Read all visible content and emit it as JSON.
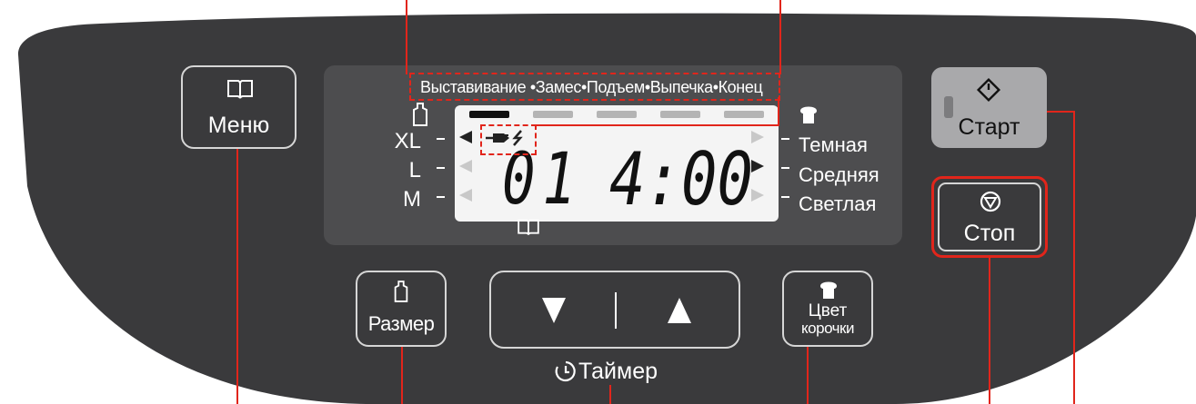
{
  "colors": {
    "panel": "#3a3a3c",
    "display": "#4d4d4f",
    "lcd": "#f4f4f4",
    "accent": "#e1251b",
    "start_button": "#a9a9ab"
  },
  "menu_button": {
    "label": "Меню",
    "icon": "book-icon"
  },
  "stages": [
    "Выставивание",
    "Замес",
    "Подъем",
    "Выпечка",
    "Конец"
  ],
  "stage_separator": "•",
  "progress": {
    "active_stage": 1,
    "total": 5
  },
  "loaf_sizes": [
    "XL",
    "L",
    "M"
  ],
  "crust_colors": [
    "Темная",
    "Средняя",
    "Светлая"
  ],
  "lcd": {
    "program": "01",
    "time": "4:00",
    "selected_crust": "Средняя",
    "icons": [
      "power-icon",
      "book-icon",
      "bread-icon",
      "loaf-size-icon"
    ]
  },
  "start_button": {
    "label": "Старт",
    "icon": "start-icon"
  },
  "stop_button": {
    "label": "Стоп",
    "icon": "stop-icon"
  },
  "size_button": {
    "label": "Размер",
    "icon": "loaf-size-icon"
  },
  "timer": {
    "down_icon": "triangle-down-icon",
    "up_icon": "triangle-up-icon",
    "label": "Таймер",
    "icon": "clock-icon"
  },
  "crust_button": {
    "label_line1": "Цвет",
    "label_line2": "корочки",
    "icon": "bread-icon"
  }
}
